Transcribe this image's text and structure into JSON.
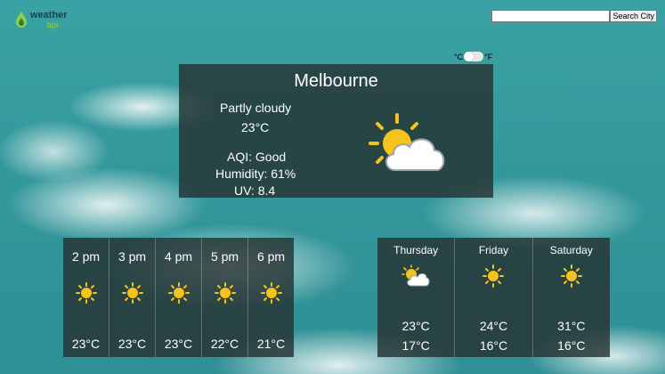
{
  "brand": {
    "word1": "weather",
    "word2": "api"
  },
  "search": {
    "placeholder": "",
    "button_label": "Search City"
  },
  "units": {
    "celsius": "°C",
    "fahrenheit": "°F",
    "selected": "celsius"
  },
  "current": {
    "city": "Melbourne",
    "condition": "Partly cloudy",
    "temp": "23°C",
    "aqi": "AQI: Good",
    "humidity": "Humidity: 61%",
    "uv": "UV: 8.4",
    "icon": "partly-cloudy-icon"
  },
  "hourly": [
    {
      "time": "2 pm",
      "temp": "23°C",
      "icon": "sun-icon"
    },
    {
      "time": "3 pm",
      "temp": "23°C",
      "icon": "sun-icon"
    },
    {
      "time": "4 pm",
      "temp": "23°C",
      "icon": "sun-icon"
    },
    {
      "time": "5 pm",
      "temp": "22°C",
      "icon": "sun-icon"
    },
    {
      "time": "6 pm",
      "temp": "21°C",
      "icon": "sun-icon"
    }
  ],
  "daily": [
    {
      "day": "Thursday",
      "high": "23°C",
      "low": "17°C",
      "icon": "partly-cloudy-icon"
    },
    {
      "day": "Friday",
      "high": "24°C",
      "low": "16°C",
      "icon": "sun-icon"
    },
    {
      "day": "Saturday",
      "high": "31°C",
      "low": "16°C",
      "icon": "sun-icon"
    }
  ],
  "colors": {
    "panel": "#263232",
    "sun": "#f6c31c",
    "sky": "#3aa2a4",
    "brand_green": "#8bd24a"
  }
}
